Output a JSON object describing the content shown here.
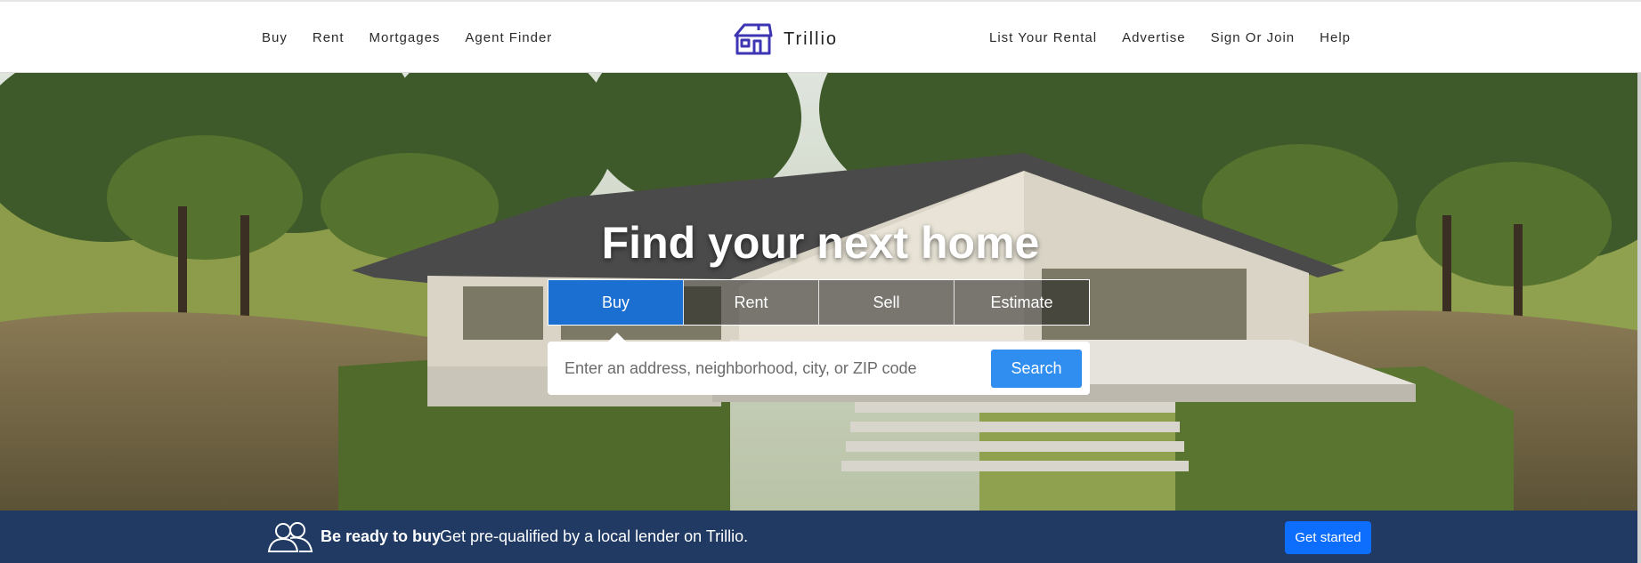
{
  "nav": {
    "left": [
      "Buy",
      "Rent",
      "Mortgages",
      "Agent Finder"
    ],
    "brand": "Trillio",
    "right": [
      "List Your Rental",
      "Advertise",
      "Sign Or Join",
      "Help"
    ]
  },
  "hero": {
    "title": "Find your next home",
    "tabs": [
      "Buy",
      "Rent",
      "Sell",
      "Estimate"
    ],
    "active_tab": "Buy",
    "search_placeholder": "Enter an address, neighborhood, city, or ZIP code",
    "search_button": "Search"
  },
  "promo": {
    "strong": "Be ready to buy",
    "text": "Get pre-qualified by a local lender on Trillio.",
    "button": "Get started"
  },
  "colors": {
    "brand_icon": "#3d35b3",
    "active_tab": "#1a6fd0",
    "search_button": "#2f8ef0",
    "promo_bar": "#203a63",
    "promo_button": "#0d6efd"
  },
  "icons": [
    "house-logo-icon",
    "people-icon"
  ]
}
